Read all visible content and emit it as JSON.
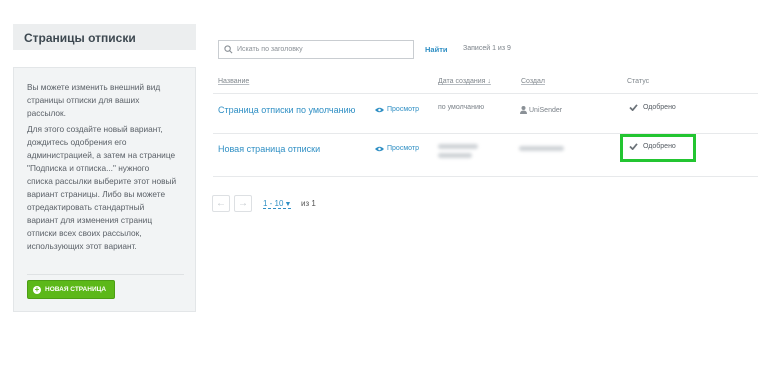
{
  "sidebar": {
    "title": "Страницы отписки",
    "paragraph1": "Вы можете изменить внешний вид страницы отписки для ваших рассылок.",
    "paragraph2": "Для этого создайте новый вариант, дождитесь одобрения его администрацией, а затем на странице \"Подписка и отписка...\" нужного списка рассылки выберите этот новый вариант страницы. Либо вы можете отредактировать стандартный вариант для изменения страниц отписки всех своих рассылок, использующих этот вариант.",
    "new_button_label": "НОВАЯ СТРАНИЦА",
    "new_button_icon": "plus-circle-icon"
  },
  "search": {
    "placeholder": "Искать по заголовку",
    "value": "",
    "find_label": "Найти",
    "records_label": "Записей 1 из 9"
  },
  "table": {
    "columns": {
      "name": "Название",
      "date": "Дата создания ↓",
      "created": "Создал",
      "status": "Статус"
    },
    "rows": [
      {
        "name": "Страница отписки по умолчанию",
        "preview": "Просмотр",
        "date": "по умолчанию",
        "created_by": "UniSender",
        "status": "Одобрено"
      },
      {
        "name": "Новая страница отписки",
        "preview": "Просмотр",
        "date": "",
        "created_by": "",
        "status": "Одобрено"
      }
    ]
  },
  "pagination": {
    "range": "1 - 10",
    "of_text": "из 1"
  },
  "colors": {
    "link": "#2f8fc4",
    "button_green": "#5cb819",
    "highlight": "#23c531"
  }
}
